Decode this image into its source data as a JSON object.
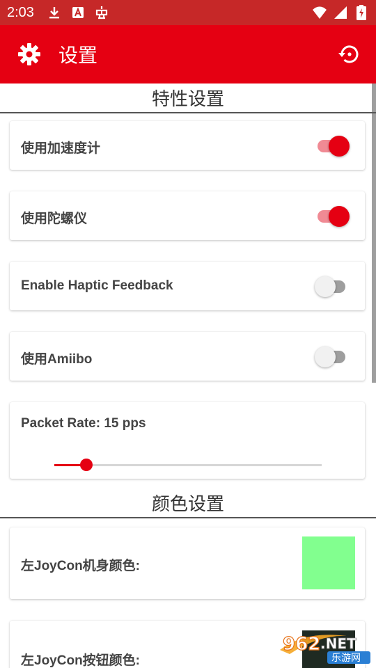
{
  "status_bar": {
    "time": "2:03",
    "bg_color": "#c62828",
    "left_icons": [
      "download-icon",
      "a-notification-icon",
      "robot-notification-icon"
    ],
    "right_icons": [
      "wifi-icon",
      "signal-icon",
      "battery-charging-icon"
    ]
  },
  "app_bar": {
    "title": "设置",
    "bg_color": "#e50012",
    "left_icon": "gear-icon",
    "right_icon": "restore-icon"
  },
  "sections": {
    "features": {
      "title": "特性设置",
      "toggles": [
        {
          "label": "使用加速度计",
          "on": true
        },
        {
          "label": "使用陀螺仪",
          "on": true
        },
        {
          "label": "Enable Haptic Feedback",
          "on": false
        },
        {
          "label": "使用Amiibo",
          "on": false
        }
      ],
      "packet_rate": {
        "label": "Packet Rate: 15 pps",
        "value_fraction": 0.12
      }
    },
    "colors": {
      "title": "颜色设置",
      "items": [
        {
          "label": "左JoyCon机身颜色:",
          "color": "#82ff8f"
        },
        {
          "label": "左JoyCon按钮颜色:",
          "color": "#1f2a22"
        }
      ]
    }
  },
  "accent_color": "#e50012",
  "watermark": {
    "text_top": "962.NET",
    "text_bottom": "乐游网"
  }
}
